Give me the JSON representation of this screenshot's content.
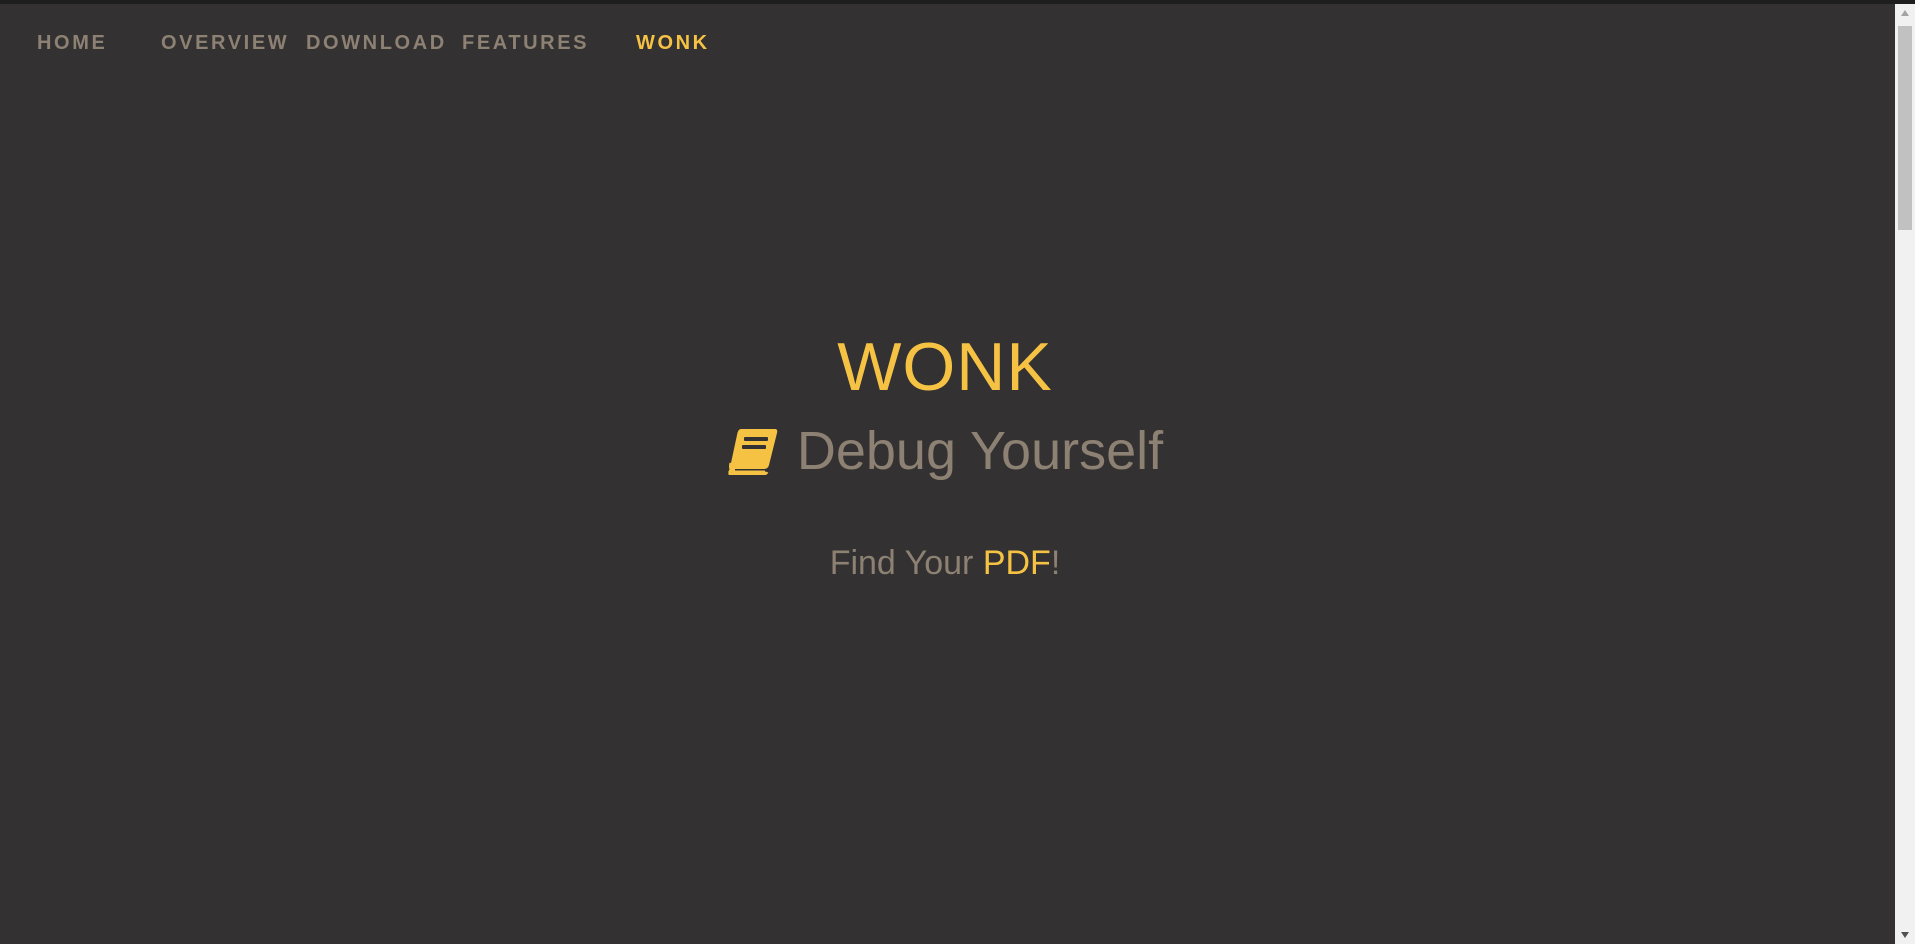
{
  "nav": {
    "items": [
      {
        "label": "HOME"
      },
      {
        "label": "OVERVIEW"
      },
      {
        "label": "DOWNLOAD"
      },
      {
        "label": "FEATURES"
      },
      {
        "label": "WONK"
      }
    ],
    "active_label": "WONK"
  },
  "hero": {
    "title": "WONK",
    "subtitle": "Debug Yourself",
    "subtitle_icon": "book-icon",
    "tagline_prefix": "Find Your ",
    "tagline_accent": "PDF",
    "tagline_suffix": "!"
  },
  "colors": {
    "background": "#333132",
    "accent": "#f5c243",
    "muted_text": "#8d8173"
  }
}
